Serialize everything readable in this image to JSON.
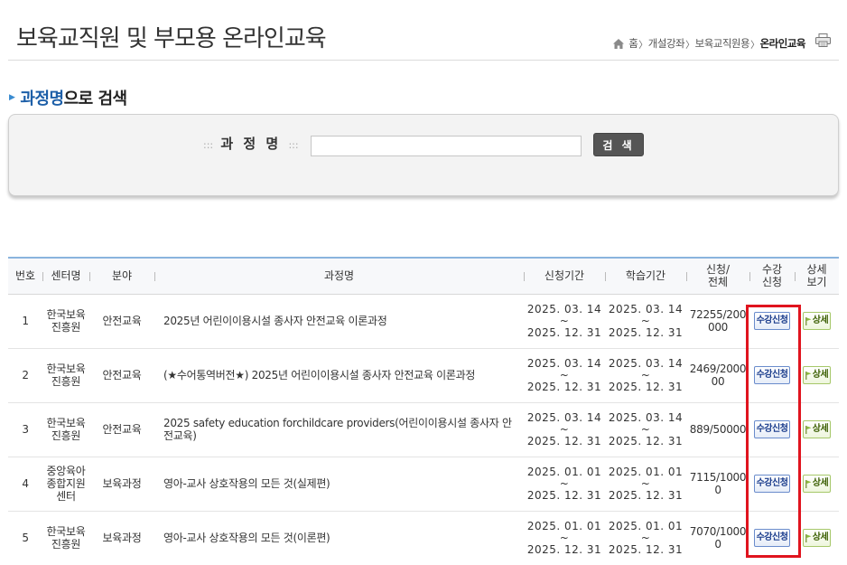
{
  "header": {
    "title": "보육교직원 및 부모용 온라인교육",
    "breadcrumb": [
      "홈",
      "개설강좌",
      "보육교직원용",
      "온라인교육"
    ]
  },
  "search": {
    "section_title_highlight": "과정명",
    "section_title_rest": "으로 검색",
    "label_text": "과 정 명",
    "label_colons": ":::",
    "input_value": "",
    "button_label": "검 색"
  },
  "table": {
    "headers": {
      "no": "번호",
      "center": "센터명",
      "field": "분야",
      "course": "과정명",
      "apply_period": "신청기간",
      "study_period": "학습기간",
      "apply_total_1": "신청/",
      "apply_total_2": "전체",
      "enroll_1": "수강",
      "enroll_2": "신청",
      "detail_1": "상세",
      "detail_2": "보기"
    },
    "rows": [
      {
        "no": "1",
        "center": "한국보육진흥원",
        "field": "안전교육",
        "course": "2025년 어린이이용시설 종사자 안전교육 이론과정",
        "apply_start": "2025. 03. 14",
        "apply_tilde": "~",
        "apply_end": "2025. 12. 31",
        "study_start": "2025. 03. 14",
        "study_tilde": "~",
        "study_end": "2025. 12. 31",
        "count": "72255/200000",
        "apply_btn": "수강신청",
        "detail_btn": "상세"
      },
      {
        "no": "2",
        "center": "한국보육진흥원",
        "field": "안전교육",
        "course": "(★수어통역버전★) 2025년 어린이이용시설 종사자 안전교육 이론과정",
        "apply_start": "2025. 03. 14",
        "apply_tilde": "~",
        "apply_end": "2025. 12. 31",
        "study_start": "2025. 03. 14",
        "study_tilde": "~",
        "study_end": "2025. 12. 31",
        "count": "2469/200000",
        "apply_btn": "수강신청",
        "detail_btn": "상세"
      },
      {
        "no": "3",
        "center": "한국보육진흥원",
        "field": "안전교육",
        "course": "2025 safety education forchildcare providers(어린이이용시설 종사자 안전교육)",
        "apply_start": "2025. 03. 14",
        "apply_tilde": "~",
        "apply_end": "2025. 12. 31",
        "study_start": "2025. 03. 14",
        "study_tilde": "~",
        "study_end": "2025. 12. 31",
        "count": "889/50000",
        "apply_btn": "수강신청",
        "detail_btn": "상세"
      },
      {
        "no": "4",
        "center": "중앙육아종합지원센터",
        "field": "보육과정",
        "course": "영아-교사 상호작용의 모든 것(실제편)",
        "apply_start": "2025. 01. 01",
        "apply_tilde": "~",
        "apply_end": "2025. 12. 31",
        "study_start": "2025. 01. 01",
        "study_tilde": "~",
        "study_end": "2025. 12. 31",
        "count": "7115/10000",
        "apply_btn": "수강신청",
        "detail_btn": "상세"
      },
      {
        "no": "5",
        "center": "한국보육진흥원",
        "field": "보육과정",
        "course": "영아-교사 상호작용의 모든 것(이론편)",
        "apply_start": "2025. 01. 01",
        "apply_tilde": "~",
        "apply_end": "2025. 12. 31",
        "study_start": "2025. 01. 01",
        "study_tilde": "~",
        "study_end": "2025. 12. 31",
        "count": "7070/10000",
        "apply_btn": "수강신청",
        "detail_btn": "상세"
      }
    ]
  },
  "colors": {
    "accent_blue": "#1d5fa8",
    "table_top_border": "#8ab4de",
    "highlight_red": "#e0141e",
    "apply_btn_text": "#1a3c8c",
    "detail_btn_text": "#3a5e00"
  }
}
